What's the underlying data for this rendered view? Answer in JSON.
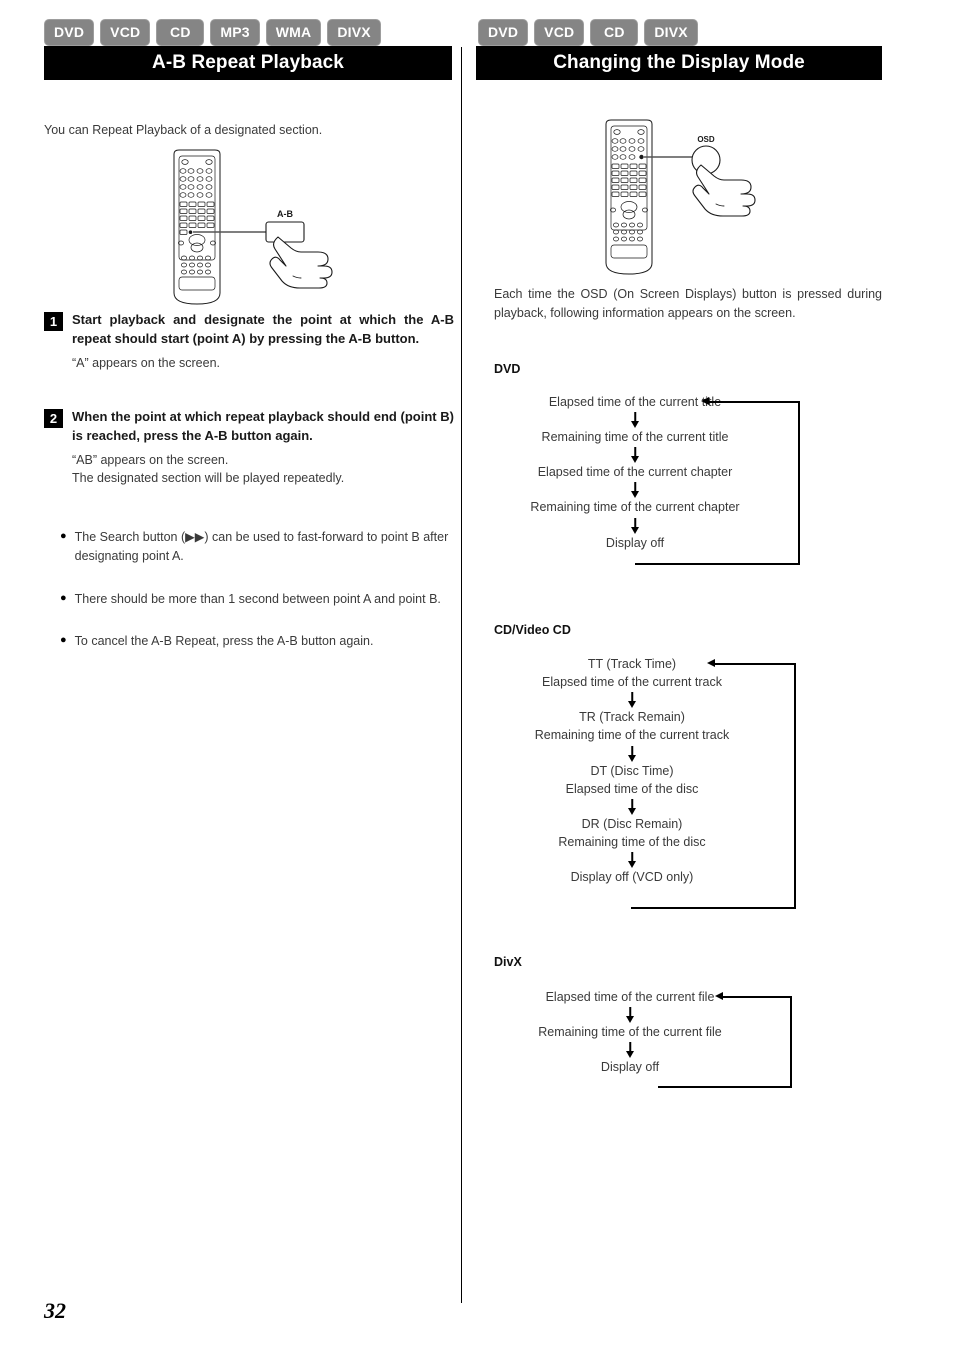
{
  "page": {
    "number": "32"
  },
  "left_column": {
    "badges": [
      "DVD",
      "VCD",
      "CD",
      "MP3",
      "WMA",
      "DIVX"
    ],
    "title": "A-B Repeat Playback",
    "intro": "You can Repeat Playback of a designated section.",
    "illustration": {
      "name": "remote-control-a-b-button",
      "callout_label": "A-B"
    },
    "steps": [
      {
        "number": "1",
        "title": "Start playback and designate the point at which the A-B repeat should start (point A) by pressing the A-B button.",
        "body": "“A” appears on the screen."
      },
      {
        "number": "2",
        "title": "When the point at which repeat playback should end (point B) is reached, press the A-B button again.",
        "body_line1": "“AB” appears on the screen.",
        "body_line2": "The designated section will be played repeatedly."
      }
    ],
    "notes": [
      "The Search button (▶▶) can be used to fast-forward to point B after designating point A.",
      "There should be more than 1 second between point A and point B.",
      "To cancel the A-B Repeat, press the A-B button again."
    ]
  },
  "right_column": {
    "badges": [
      "DVD",
      "VCD",
      "CD",
      "DIVX"
    ],
    "title": "Changing the Display Mode",
    "illustration": {
      "name": "remote-control-osd-button",
      "callout_label": "OSD"
    },
    "intro": "Each time the OSD (On Screen Displays) button is pressed during playback, following information appears on the screen.",
    "flows": [
      {
        "label": "DVD",
        "steps": [
          {
            "main": "Elapsed time of the current title"
          },
          {
            "main": "Remaining time of the current title"
          },
          {
            "main": "Elapsed time of the current chapter"
          },
          {
            "main": "Remaining time of the current chapter"
          },
          {
            "main": "Display off"
          }
        ]
      },
      {
        "label": "CD/Video CD",
        "steps": [
          {
            "main": "TT (Track Time)",
            "sub": "Elapsed time of the current track"
          },
          {
            "main": "TR (Track Remain)",
            "sub": "Remaining time of the current track"
          },
          {
            "main": "DT (Disc Time)",
            "sub": "Elapsed time of the disc"
          },
          {
            "main": "DR (Disc Remain)",
            "sub": "Remaining time of the disc"
          },
          {
            "main": "Display off (VCD only)"
          }
        ]
      },
      {
        "label": "DivX",
        "steps": [
          {
            "main": "Elapsed time of the current file"
          },
          {
            "main": "Remaining time of the current file"
          },
          {
            "main": "Display off"
          }
        ]
      }
    ]
  },
  "colors": {
    "badge_bg": "#858585",
    "title_bar_bg": "#000000",
    "body_text": "#3a3a3a"
  }
}
